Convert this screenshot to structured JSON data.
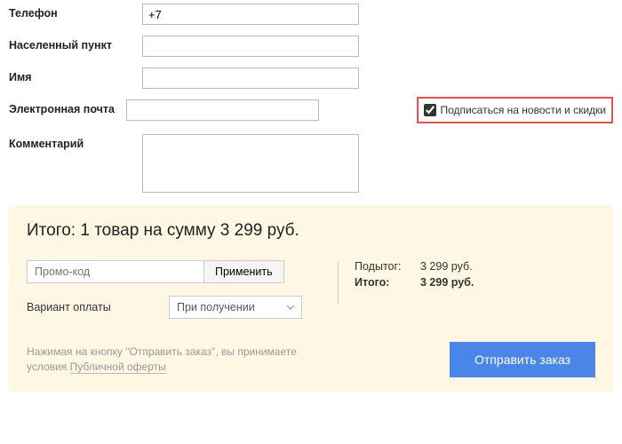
{
  "form": {
    "phone_label": "Телефон",
    "phone_value": "+7",
    "city_label": "Населенный пункт",
    "city_value": "",
    "name_label": "Имя",
    "name_value": "",
    "email_label": "Электронная почта",
    "email_value": "",
    "comment_label": "Комментарий",
    "comment_value": "",
    "subscribe_label": "Подписаться на новости и скидки",
    "subscribe_checked": true
  },
  "summary": {
    "title": "Итого: 1 товар на сумму 3 299 руб.",
    "promo_placeholder": "Промо-код",
    "promo_btn": "Применить",
    "payment_label": "Вариант оплаты",
    "payment_selected": "При получении",
    "subtotal_label": "Подытог:",
    "subtotal_value": "3 299 руб.",
    "total_label": "Итого:",
    "total_value": "3 299 руб.",
    "disclaimer_pre": "Нажимая на кнопку \"Отправить заказ\", вы принимаете условия ",
    "disclaimer_link": "Публичной оферты",
    "submit_label": "Отправить заказ"
  }
}
